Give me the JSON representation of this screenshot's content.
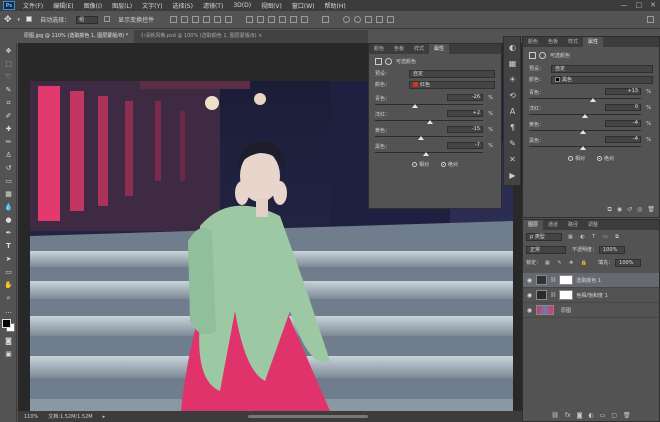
{
  "menu": {
    "logo": "Ps",
    "items": [
      "文件(F)",
      "编辑(E)",
      "图像(I)",
      "图层(L)",
      "文字(Y)",
      "选择(S)",
      "滤镜(T)",
      "3D(D)",
      "视图(V)",
      "窗口(W)",
      "帮助(H)"
    ],
    "window_buttons": [
      "—",
      "□",
      "✕"
    ]
  },
  "options": {
    "auto_select_label": "自动选择：",
    "auto_select_value": "组",
    "show_transform_label": "显示变换控件"
  },
  "tabs": [
    {
      "label": "原图.jpg @ 110% (选取颜色 1, 图层蒙版/8) *",
      "active": true
    },
    {
      "label": "小清新风格.psd @ 100% (选取颜色 1, 图层蒙版/8) ×",
      "active": false
    }
  ],
  "status": {
    "zoom": "110%",
    "doc": "文档:1.52M/1.52M"
  },
  "properties_left": {
    "tabs": [
      "颜色",
      "色板",
      "样式",
      "属性"
    ],
    "title": "可选颜色",
    "preset_label": "预设：",
    "preset_value": "自定",
    "color_label": "颜色：",
    "color_value": "红色",
    "color_swatch": "#d8321f",
    "sliders": [
      {
        "label": "青色：",
        "value": "-26",
        "pos": 0.37
      },
      {
        "label": "洋红：",
        "value": "+2",
        "pos": 0.51
      },
      {
        "label": "黄色：",
        "value": "-15",
        "pos": 0.43
      },
      {
        "label": "黑色：",
        "value": "-7",
        "pos": 0.47
      }
    ],
    "pct": "%",
    "radio": {
      "relative": "相对",
      "absolute": "绝对",
      "selected": "absolute"
    }
  },
  "properties_right": {
    "tabs": [
      "颜色",
      "色板",
      "样式",
      "属性"
    ],
    "title": "可选颜色",
    "preset_label": "预设：",
    "preset_value": "自定",
    "color_label": "颜色：",
    "color_value": "黑色",
    "color_swatch": "#000000",
    "sliders": [
      {
        "label": "青色：",
        "value": "+13",
        "pos": 0.57
      },
      {
        "label": "洋红：",
        "value": "0",
        "pos": 0.5
      },
      {
        "label": "黄色：",
        "value": "-4",
        "pos": 0.48
      },
      {
        "label": "黑色：",
        "value": "-4",
        "pos": 0.48
      }
    ],
    "pct": "%",
    "radio": {
      "relative": "相对",
      "absolute": "绝对",
      "selected": "absolute"
    }
  },
  "layers": {
    "tabs": [
      "图层",
      "通道",
      "路径",
      "调整"
    ],
    "filter_label": "ρ 类型",
    "blend_mode": "正常",
    "opacity_label": "不透明度：",
    "opacity_value": "100%",
    "lock_label": "锁定：",
    "fill_label": "填充：",
    "fill_value": "100%",
    "items": [
      {
        "name": "选取颜色 1",
        "type": "adjustment",
        "selected": true
      },
      {
        "name": "色相/饱和度 1",
        "type": "adjustment",
        "selected": false
      },
      {
        "name": "原图",
        "type": "image",
        "selected": false
      }
    ]
  }
}
